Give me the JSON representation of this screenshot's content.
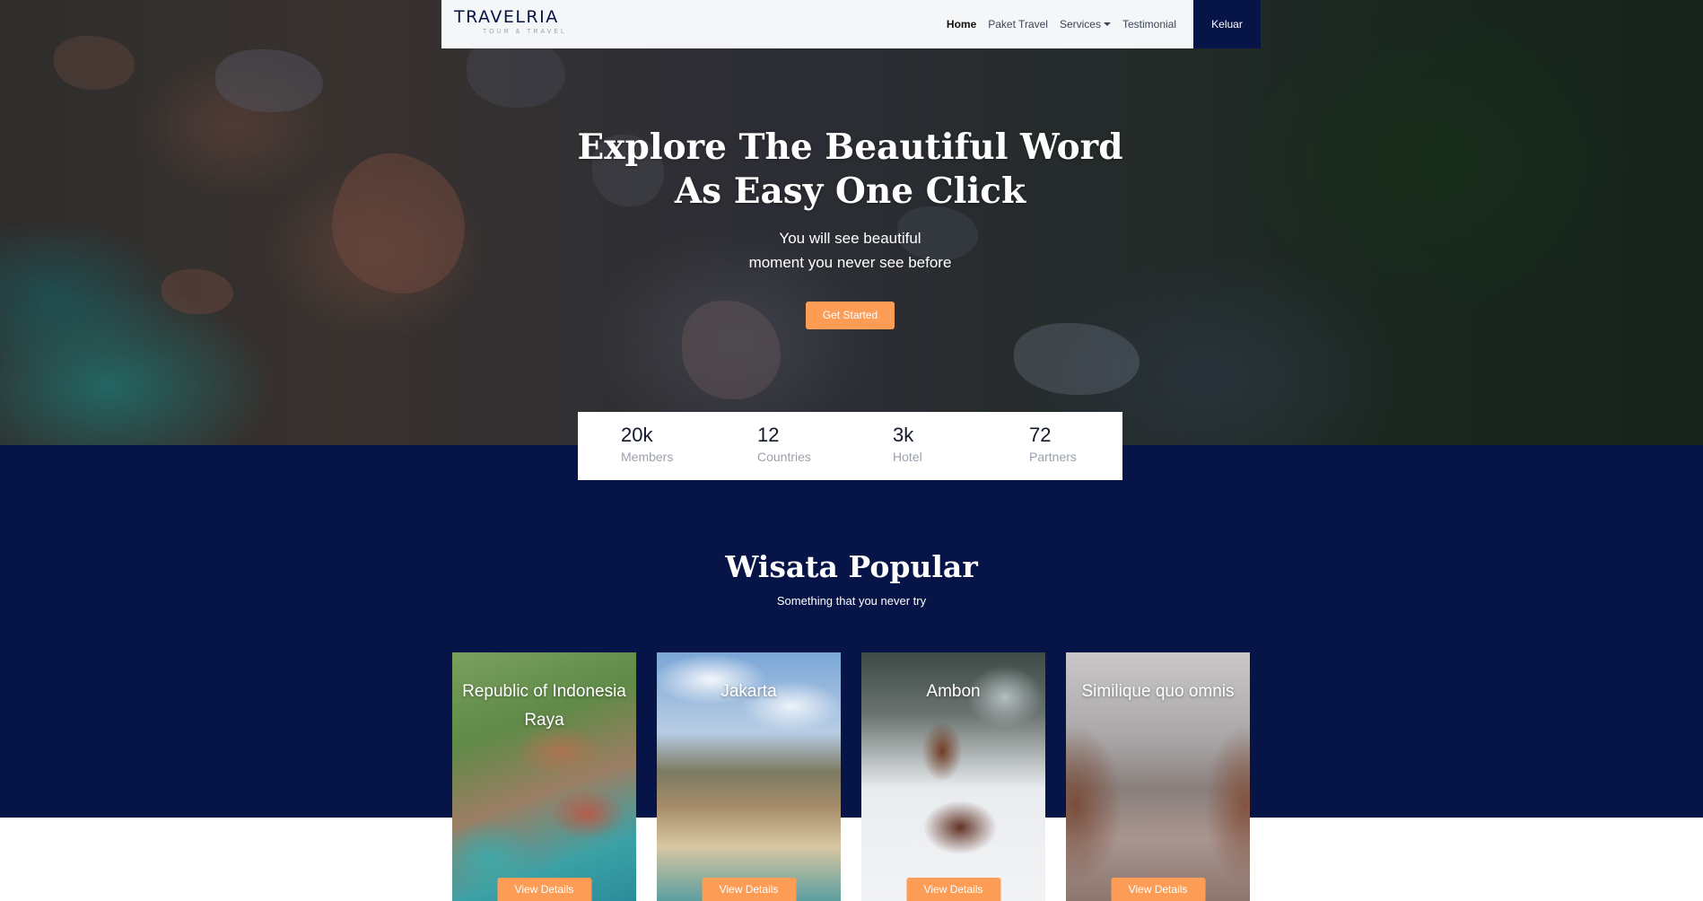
{
  "brand": {
    "name": "TRAVELRIA",
    "tagline": "TOUR & TRAVEL"
  },
  "nav": {
    "items": [
      {
        "label": "Home",
        "active": true
      },
      {
        "label": "Paket Travel",
        "active": false
      },
      {
        "label": "Services",
        "active": false,
        "dropdown": true
      },
      {
        "label": "Testimonial",
        "active": false
      }
    ],
    "logout_label": "Keluar"
  },
  "hero": {
    "title_line1": "Explore The Beautiful Word",
    "title_line2": "As Easy One Click",
    "subtitle_line1": "You will see beautiful",
    "subtitle_line2": "moment you never see before",
    "cta_label": "Get Started"
  },
  "stats": [
    {
      "value": "20k",
      "label": "Members"
    },
    {
      "value": "12",
      "label": "Countries"
    },
    {
      "value": "3k",
      "label": "Hotel"
    },
    {
      "value": "72",
      "label": "Partners"
    }
  ],
  "popular": {
    "title": "Wisata Popular",
    "subtitle": "Something that you never try",
    "cards": [
      {
        "title": "Republic of Indonesia Raya",
        "button": "View Details"
      },
      {
        "title": "Jakarta",
        "button": "View Details"
      },
      {
        "title": "Ambon",
        "button": "View Details"
      },
      {
        "title": "Similique quo omnis",
        "button": "View Details"
      }
    ]
  },
  "colors": {
    "navy": "#071447",
    "accent": "#fd9d55",
    "navbar_bg": "#f5f6f8"
  }
}
